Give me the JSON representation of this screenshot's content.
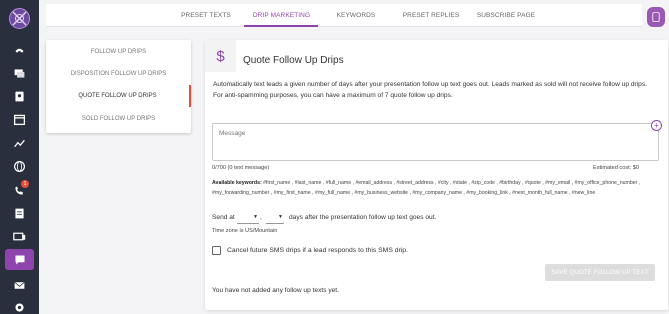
{
  "tabs": [
    {
      "label": "PRESET TEXTS"
    },
    {
      "label": "DRIP MARKETING"
    },
    {
      "label": "KEYWORDS"
    },
    {
      "label": "PRESET REPLIES"
    },
    {
      "label": "SUBSCRIBE PAGE"
    }
  ],
  "active_tab": "DRIP MARKETING",
  "drip_menu": [
    {
      "label": "FOLLOW UP DRIPS"
    },
    {
      "label": "DISPOSITION FOLLOW UP DRIPS"
    },
    {
      "label": "QUOTE FOLLOW UP DRIPS"
    },
    {
      "label": "SOLD FOLLOW UP DRIPS"
    }
  ],
  "sidebar": {
    "notification_count": "1"
  },
  "main": {
    "icon": "dollar-icon",
    "title": "Quote Follow Up Drips",
    "description": "Automatically text leads a given number of days after your presentation follow up text goes out. Leads marked as sold will not receive follow up drips. For anti-spamming purposes, you can have a maximum of 7 quote follow up drips.",
    "message_placeholder": "Message",
    "counter": "0/700 (0 text message)",
    "estimated_cost": "Estimated cost: $0",
    "keywords_label": "Available keywords:",
    "keywords": "#first_name , #last_name , #full_name , #email_address , #street_address , #city , #state , #zip_code , #birthday , #quote , #my_email , #my_office_phone_number , #my_forwarding_number , #my_first_name , #my_full_name , #my_business_website , #my_company_name , #my_booking_link , #next_month_full_name , #new_line",
    "send_at": "Send at",
    "days_select": "",
    "time_select": "",
    "comma": ",",
    "after_text": "days after the presentation follow up text goes out.",
    "timezone": "Time zone is US/Mountain",
    "cancel_label": "Cancel future SMS drips if a lead responds to this SMS drip.",
    "save_button": "SAVE QUOTE FOLLOW UP TEXT",
    "empty_note": "You have not added any follow up texts yet."
  },
  "colors": {
    "accent": "#8e44ad",
    "sidebar": "#2a2f3d",
    "badge": "#e74c3c",
    "active_marker": "#e74c3c"
  }
}
